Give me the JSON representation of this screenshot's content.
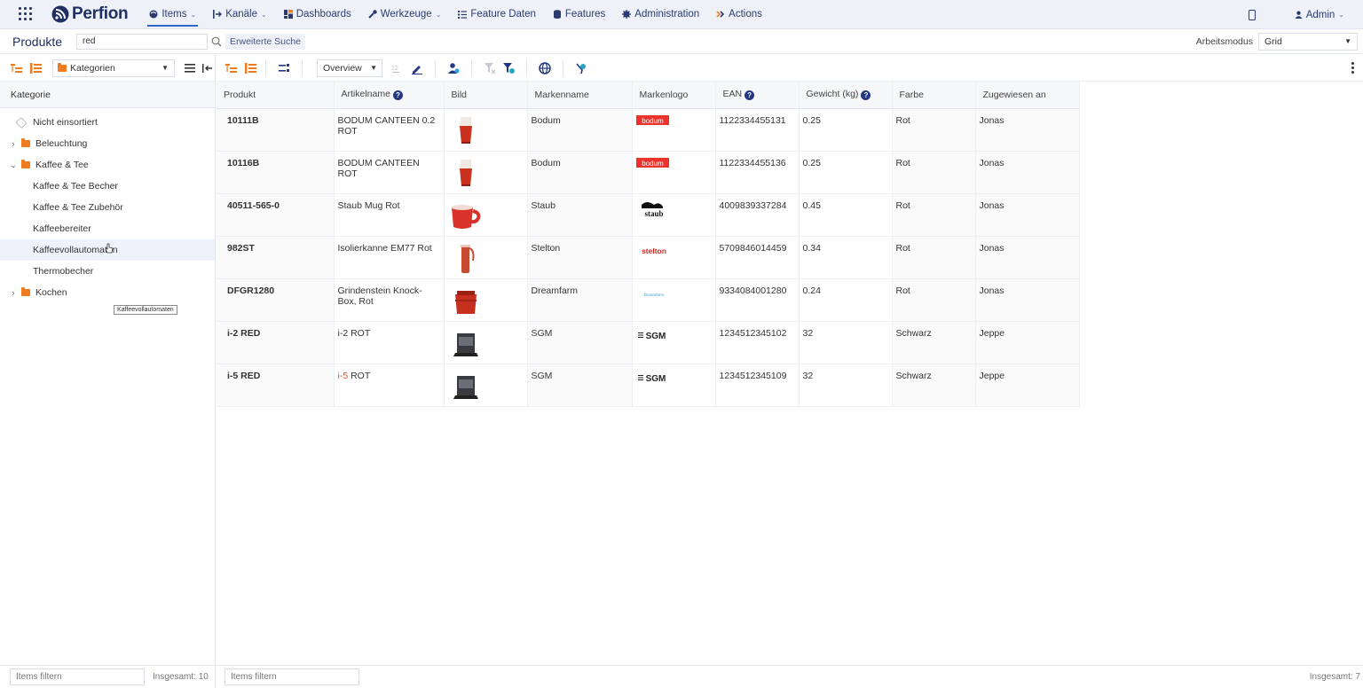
{
  "app": {
    "name": "Perfion"
  },
  "nav": {
    "items": [
      {
        "label": "Items",
        "active": true,
        "caret": true,
        "icon": "box-icon"
      },
      {
        "label": "Kanäle",
        "caret": true,
        "icon": "channel-icon"
      },
      {
        "label": "Dashboards",
        "icon": "dashboard-icon"
      },
      {
        "label": "Werkzeuge",
        "caret": true,
        "icon": "wrench-icon"
      },
      {
        "label": "Feature Daten",
        "icon": "feature-data-icon"
      },
      {
        "label": "Features",
        "icon": "database-icon"
      },
      {
        "label": "Administration",
        "icon": "gear-icon"
      },
      {
        "label": "Actions",
        "icon": "actions-icon"
      }
    ],
    "user": "Admin"
  },
  "search": {
    "page_title": "Produkte",
    "query": "red",
    "advanced_label": "Erweiterte Suche",
    "mode_label": "Arbeitsmodus",
    "mode_value": "Grid"
  },
  "left": {
    "category_select": "Kategorien",
    "header": "Kategorie",
    "tree": [
      {
        "label": "Nicht einsortiert",
        "type": "tag"
      },
      {
        "label": "Beleuchtung",
        "type": "folder",
        "arrow": "›"
      },
      {
        "label": "Kaffee & Tee",
        "type": "folder",
        "arrow": "⌄"
      },
      {
        "label": "Kaffee & Tee Becher",
        "type": "child"
      },
      {
        "label": "Kaffee & Tee Zubehör",
        "type": "child"
      },
      {
        "label": "Kaffeebereiter",
        "type": "child"
      },
      {
        "label": "Kaffeevollautomaten",
        "type": "child",
        "highlight": true
      },
      {
        "label": "Thermobecher",
        "type": "child"
      },
      {
        "label": "Kochen",
        "type": "folder",
        "arrow": "›"
      }
    ],
    "tooltip": "Kaffeevollautomaten",
    "filter_placeholder": "Items filtern",
    "total": "Insgesamt: 10"
  },
  "main": {
    "view_select": "Overview",
    "columns": [
      "Produkt",
      "Artikelname",
      "Bild",
      "Markenname",
      "Markenlogo",
      "EAN",
      "Gewicht (kg)",
      "Farbe",
      "Zugewiesen an"
    ],
    "rows": [
      {
        "produkt": "10111B",
        "artikel": "BODUM CANTEEN 0.2 ROT",
        "image": "red-canteen-cup",
        "marke": "Bodum",
        "logo": "bodum",
        "ean": "1122334455131",
        "gewicht": "0.25",
        "farbe": "Rot",
        "zugewiesen": "Jonas"
      },
      {
        "produkt": "10116B",
        "artikel": "BODUM CANTEEN ROT",
        "image": "red-canteen-cup",
        "marke": "Bodum",
        "logo": "bodum",
        "ean": "1122334455136",
        "gewicht": "0.25",
        "farbe": "Rot",
        "zugewiesen": "Jonas"
      },
      {
        "produkt": "40511-565-0",
        "artikel": "Staub Mug Rot",
        "image": "red-mug",
        "marke": "Staub",
        "logo": "staub",
        "ean": "4009839337284",
        "gewicht": "0.45",
        "farbe": "Rot",
        "zugewiesen": "Jonas"
      },
      {
        "produkt": "982ST",
        "artikel": "Isolierkanne EM77 Rot",
        "image": "red-vacuum-jug",
        "marke": "Stelton",
        "logo": "stelton",
        "ean": "5709846014459",
        "gewicht": "0.34",
        "farbe": "Rot",
        "zugewiesen": "Jonas"
      },
      {
        "produkt": "DFGR1280",
        "artikel": "Grindenstein Knock-Box, Rot",
        "image": "red-knock-box",
        "marke": "Dreamfarm",
        "logo": "dreamfarm",
        "ean": "9334084001280",
        "gewicht": "0.24",
        "farbe": "Rot",
        "zugewiesen": "Jonas"
      },
      {
        "produkt": "i-2 RED",
        "artikel": "i-2 ROT",
        "image": "black-device",
        "marke": "SGM",
        "logo": "sgm",
        "ean": "1234512345102",
        "gewicht": "32",
        "farbe": "Schwarz",
        "zugewiesen": "Jeppe"
      },
      {
        "produkt": "i-5 RED",
        "artikel_prefix": "i-5",
        "artikel_suffix": " ROT",
        "image": "black-device",
        "marke": "SGM",
        "logo": "sgm",
        "ean": "1234512345109",
        "gewicht": "32",
        "farbe": "Schwarz",
        "zugewiesen": "Jeppe"
      }
    ],
    "logo_texts": {
      "bodum": "bodum",
      "staub": "staub",
      "stelton": "stelton",
      "dreamfarm": "Dreamfarm",
      "sgm": "SGM"
    },
    "filter_placeholder": "Items filtern",
    "total": "Insgesamt: 7"
  }
}
